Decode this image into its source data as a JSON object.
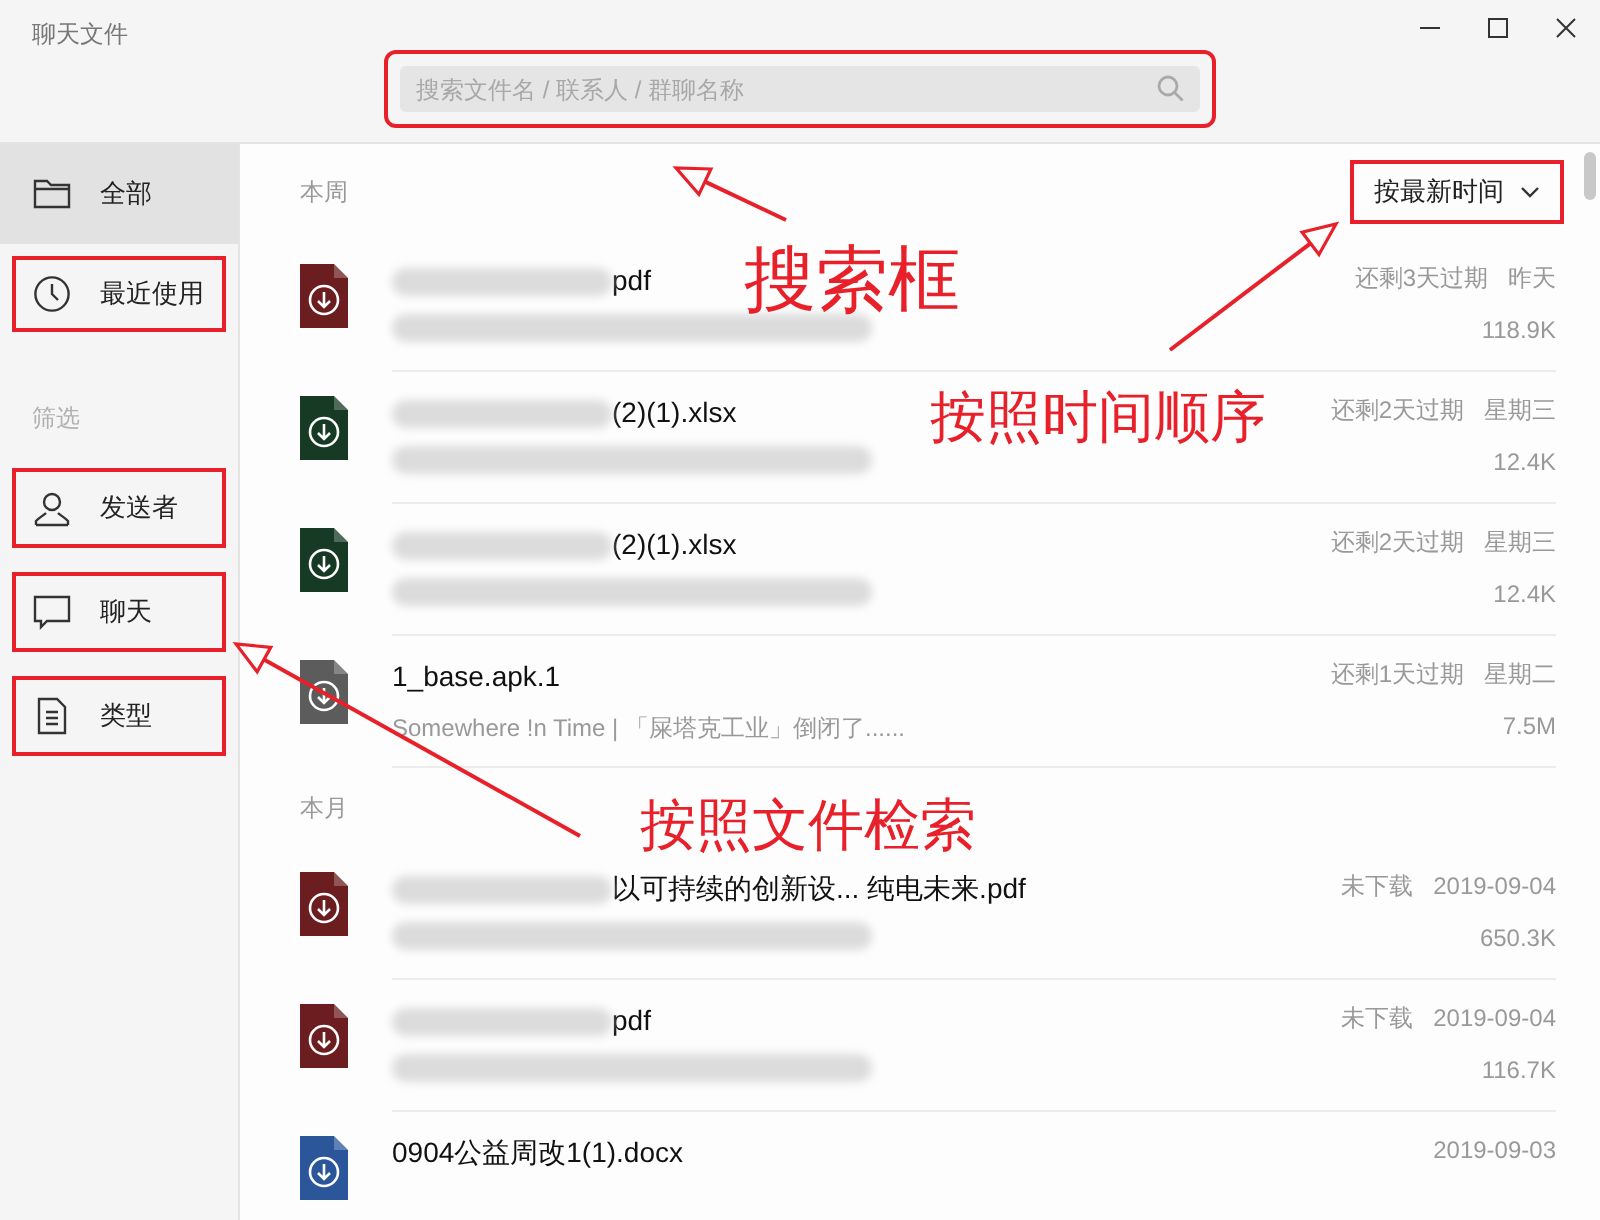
{
  "window": {
    "title": "聊天文件"
  },
  "search": {
    "placeholder": "搜索文件名 / 联系人 / 群聊名称",
    "annotated": true
  },
  "sidebar": {
    "items": [
      {
        "label": "全部",
        "kind": "folder",
        "selected": true,
        "annotated": false
      },
      {
        "label": "最近使用",
        "kind": "clock",
        "selected": false,
        "annotated": true
      }
    ],
    "filter_heading": "筛选",
    "filters": [
      {
        "label": "发送者",
        "kind": "person",
        "annotated": true
      },
      {
        "label": "聊天",
        "kind": "chat",
        "annotated": true
      },
      {
        "label": "类型",
        "kind": "document",
        "annotated": true
      }
    ]
  },
  "sort": {
    "label": "按最新时间",
    "annotated": true
  },
  "sections": [
    {
      "heading": "本周",
      "files": [
        {
          "color": "#6b1d1f",
          "name": "pdf",
          "name_redacted": true,
          "note_redacted": true,
          "status": "还剩3天过期",
          "date": "昨天",
          "size": "118.9K"
        },
        {
          "color": "#163a24",
          "name": "(2)(1).xlsx",
          "name_redacted": true,
          "note_redacted": true,
          "status": "还剩2天过期",
          "date": "星期三",
          "size": "12.4K"
        },
        {
          "color": "#163a24",
          "name": "(2)(1).xlsx",
          "name_redacted": true,
          "note_redacted": true,
          "status": "还剩2天过期",
          "date": "星期三",
          "size": "12.4K"
        },
        {
          "color": "#5c5c5c",
          "name": "1_base.apk.1",
          "name_redacted": false,
          "note": "Somewhere !n Time | 「屎塔克工业」倒闭了......",
          "note_redacted": false,
          "status": "还剩1天过期",
          "date": "星期二",
          "size": "7.5M"
        }
      ]
    },
    {
      "heading": "本月",
      "files": [
        {
          "color": "#6b1d1f",
          "name": "以可持续的创新设...  纯电未来.pdf",
          "name_redacted": true,
          "note_redacted": true,
          "status": "未下载",
          "date": "2019-09-04",
          "size": "650.3K"
        },
        {
          "color": "#6b1d1f",
          "name": "pdf",
          "name_redacted": true,
          "note_redacted": true,
          "status": "未下载",
          "date": "2019-09-04",
          "size": "116.7K"
        },
        {
          "color": "#2b579a",
          "name": "0904公益周改1(1).docx",
          "name_redacted": false,
          "note_redacted": false,
          "date": "2019-09-03"
        }
      ]
    }
  ],
  "callouts": [
    {
      "text": "搜索框"
    },
    {
      "text": "按照时间顺序"
    },
    {
      "text": "按照文件检索"
    }
  ]
}
